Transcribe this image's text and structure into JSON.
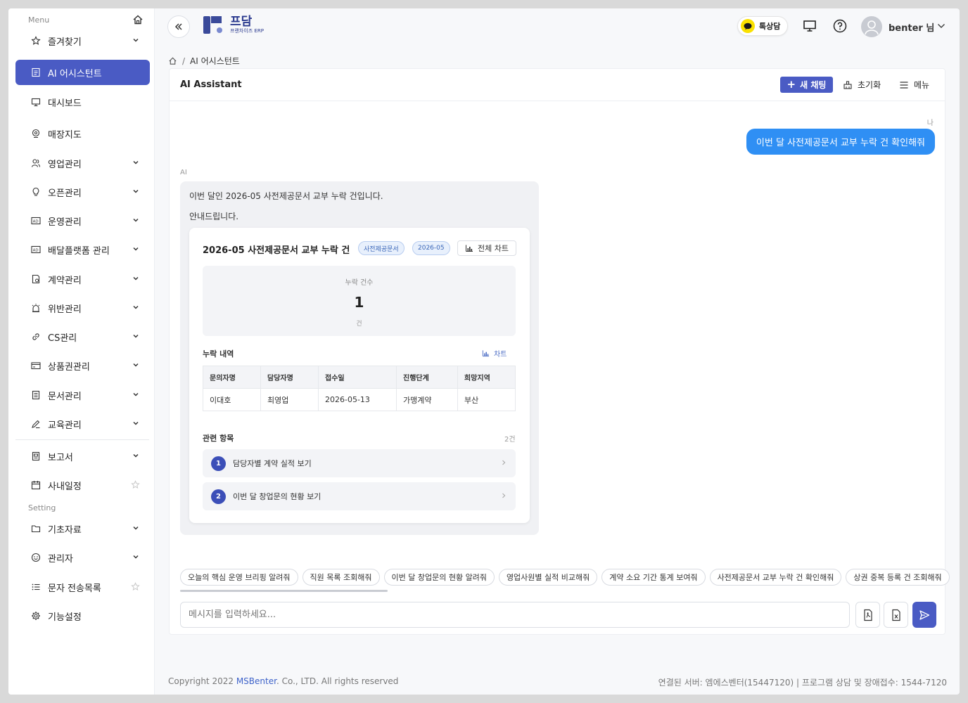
{
  "sidebar": {
    "menu_label": "Menu",
    "setting_label": "Setting",
    "items": [
      {
        "label": "즐겨찾기",
        "icon": "star-icon"
      },
      {
        "label": "AI 어시스턴트",
        "icon": "assistant-icon"
      },
      {
        "label": "대시보드",
        "icon": "monitor-icon"
      },
      {
        "label": "매장지도",
        "icon": "map-pin-icon"
      },
      {
        "label": "영업관리",
        "icon": "users-icon"
      },
      {
        "label": "오픈관리",
        "icon": "bulb-icon"
      },
      {
        "label": "운영관리",
        "icon": "ad-icon"
      },
      {
        "label": "배달플랫폼 관리",
        "icon": "ad-icon"
      },
      {
        "label": "계약관리",
        "icon": "contract-icon"
      },
      {
        "label": "위반관리",
        "icon": "alarm-icon"
      },
      {
        "label": "CS관리",
        "icon": "link-icon"
      },
      {
        "label": "상품권관리",
        "icon": "card-icon"
      },
      {
        "label": "문서관리",
        "icon": "document-icon"
      },
      {
        "label": "교육관리",
        "icon": "pen-icon"
      },
      {
        "label": "보고서",
        "icon": "report-icon"
      },
      {
        "label": "사내일정",
        "icon": "calendar-icon"
      },
      {
        "label": "기초자료",
        "icon": "folder-icon"
      },
      {
        "label": "관리자",
        "icon": "admin-icon"
      },
      {
        "label": "문자 전송목록",
        "icon": "list-icon"
      },
      {
        "label": "기능설정",
        "icon": "gear-icon"
      }
    ]
  },
  "header": {
    "logo_title": "프담",
    "logo_sub": "프랜차이즈 ERP",
    "kakao_label": "톡상담",
    "user_name": "benter 님"
  },
  "breadcrumb": {
    "current": "AI 어시스턴트"
  },
  "panel": {
    "title": "AI Assistant",
    "new_chat": "새 채팅",
    "reset": "초기화",
    "menu": "메뉴"
  },
  "chat": {
    "me_label": "나",
    "user_message": "이번 달 사전제공문서 교부 누락 건 확인해줘",
    "ai_label": "AI",
    "ai_line1": "이번 달인 2026-05 사전제공문서 교부 누락 건입니다.",
    "ai_line2": "안내드립니다.",
    "card": {
      "title": "2026-05 사전제공문서 교부 누락 건",
      "tag1": "사전제공문서",
      "tag2": "2026-05",
      "full_chart": "전체 차트",
      "stat_label": "누락 건수",
      "stat_value": "1",
      "stat_unit": "건",
      "list_title": "누락 내역",
      "chart_link": "차트",
      "table": {
        "headers": [
          "문의자명",
          "담당자명",
          "접수일",
          "진행단계",
          "희망지역"
        ],
        "rows": [
          [
            "이대호",
            "최영업",
            "2026-05-13",
            "가맹계약",
            "부산"
          ]
        ]
      },
      "related_title": "관련 항목",
      "related_count": "2건",
      "related": [
        {
          "num": "1",
          "label": "담당자별 계약 실적 보기"
        },
        {
          "num": "2",
          "label": "이번 달 창업문의 현황 보기"
        }
      ]
    }
  },
  "suggestions": [
    "오늘의 핵심 운영 브리핑 알려줘",
    "직원 목록 조회해줘",
    "이번 달 창업문의 현황 알려줘",
    "영업사원별 실적 비교해줘",
    "계약 소요 기간 통계 보여줘",
    "사전제공문서 교부 누락 건 확인해줘",
    "상권 중복 등록 건 조회해줘"
  ],
  "input": {
    "placeholder": "메시지를 입력하세요..."
  },
  "footer": {
    "copyright_pre": "Copyright 2022 ",
    "brand": "MSBenter",
    "copyright_post": ". Co., LTD. All rights reserved",
    "right": "연결된 서버: 엠에스벤터(15447120) | 프로그램 상담 및 장애접수: 1544-7120"
  },
  "colors": {
    "accent": "#4a5bc4",
    "user_bubble": "#2f8ff4",
    "kakao": "#fae100"
  }
}
